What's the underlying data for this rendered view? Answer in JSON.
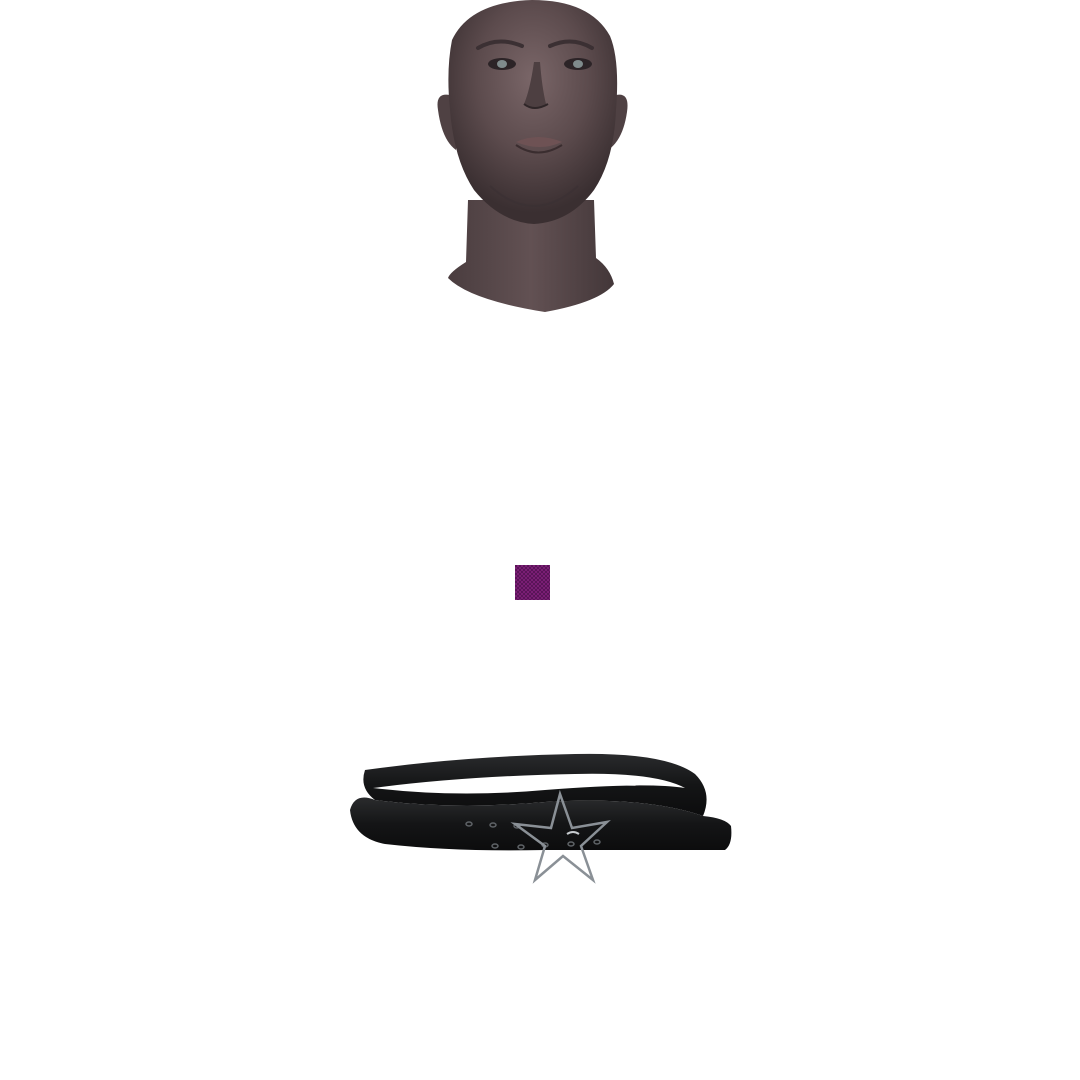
{
  "scene": {
    "background": "#ffffff",
    "items": [
      {
        "name": "head-model",
        "icon": "male-head-icon",
        "skin_color": "#5a4a4c"
      },
      {
        "name": "color-swatch",
        "icon": "purple-swatch-icon",
        "color": "#7a1e74"
      },
      {
        "name": "belt-model",
        "icon": "star-buckle-belt-icon",
        "color": "#151617",
        "buckle_color": "#8a9096"
      }
    ]
  }
}
